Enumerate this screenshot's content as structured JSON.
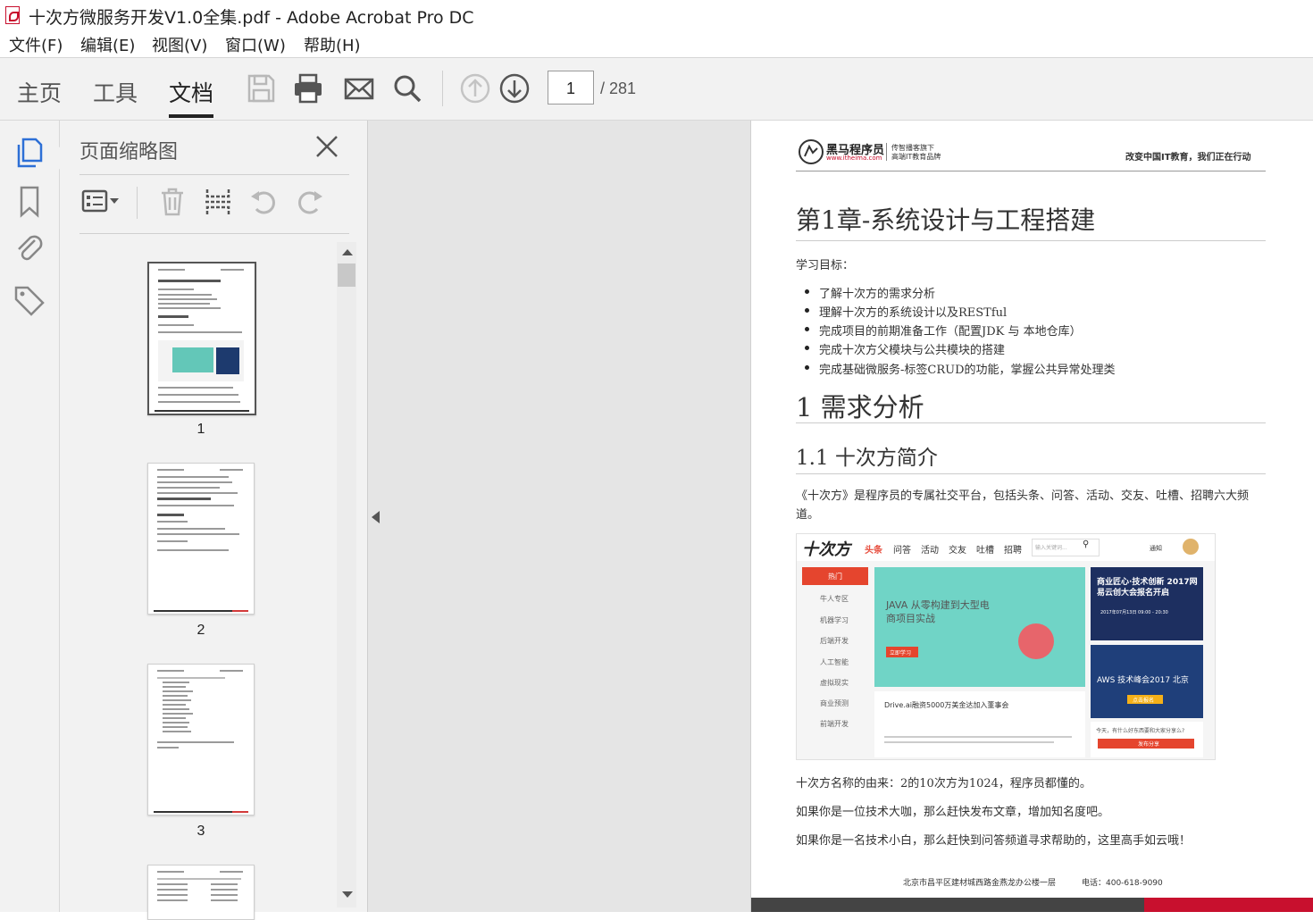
{
  "window": {
    "title": "十次方微服务开发V1.0全集.pdf - Adobe Acrobat Pro DC"
  },
  "menu": {
    "items": [
      "文件(F)",
      "编辑(E)",
      "视图(V)",
      "窗口(W)",
      "帮助(H)"
    ]
  },
  "toolbar": {
    "tabs": [
      "主页",
      "工具",
      "文档"
    ],
    "active_tab": "文档",
    "icons": [
      "save-icon",
      "print-icon",
      "email-icon",
      "search-icon",
      "prev-page-icon",
      "next-page-icon"
    ],
    "page_current": "1",
    "page_total": "/ 281"
  },
  "left_rail": {
    "icons": [
      "page-thumbnails-icon",
      "bookmark-icon",
      "attachment-icon",
      "tag-icon"
    ]
  },
  "thumbnail_panel": {
    "title": "页面缩略图",
    "tools": [
      "options-icon",
      "delete-icon",
      "insert-pages-icon",
      "rotate-ccw-icon",
      "rotate-cw-icon"
    ],
    "pages": [
      "1",
      "2",
      "3"
    ]
  },
  "document": {
    "logo_text": "黑马程序员",
    "logo_sub1": "传智播客旗下",
    "logo_sub2": "高端IT教育品牌",
    "logo_url": "www.itheima.com",
    "header_right": "改变中国IT教育，我们正在行动",
    "chapter_title": "第1章-系统设计与工程搭建",
    "objectives_label": "学习目标：",
    "objectives": [
      "了解十次方的需求分析",
      "理解十次方的系统设计以及RESTful",
      "完成项目的前期准备工作（配置JDK 与 本地仓库）",
      "完成十次方父模块与公共模块的搭建",
      "完成基础微服务-标签CRUD的功能，掌握公共异常处理类"
    ],
    "h1": "1 需求分析",
    "h2": "1.1 十次方简介",
    "intro": "《十次方》是程序员的专属社交平台，包括头条、问答、活动、交友、吐槽、招聘六大频道。",
    "screenshot": {
      "brand": "十次方",
      "nav": [
        "头条",
        "问答",
        "活动",
        "交友",
        "吐槽",
        "招聘"
      ],
      "search_placeholder": "输入关键词...",
      "notify": "通知",
      "side_button": "热门",
      "side_items": [
        "牛人专区",
        "机器学习",
        "后端开发",
        "人工智能",
        "虚拟现实",
        "商业预测",
        "前端开发"
      ],
      "banner_title": "JAVA 从零构建到大型电商项目实战",
      "banner_btn": "立即学习",
      "ad1_title": "商业匠心·技术创新 2017网易云创大会报名开启",
      "ad1_detail": "2017年07月13日 09:00 - 20:30",
      "ad2_title": "AWS 技术峰会2017 北京",
      "ad2_btn": "点击报名",
      "article_title": "Drive.ai融资5000万美金达加入董事会",
      "ask_prompt": "今天，有什么好东西要和大家分享么?",
      "share_btn": "发布分享"
    },
    "para1": "十次方名称的由来：2的10次方为1024，程序员都懂的。",
    "para2": "如果你是一位技术大咖，那么赶快发布文章，增加知名度吧。",
    "para3": "如果你是一名技术小白，那么赶快到问答频道寻求帮助的，这里高手如云哦！",
    "footer_address": "北京市昌平区建材城西路金燕龙办公楼一层",
    "footer_phone": "电话：400-618-9090"
  }
}
